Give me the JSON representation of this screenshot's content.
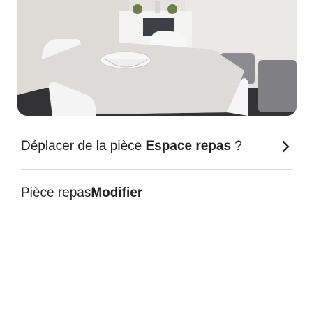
{
  "photo": {
    "alt_icon": "dining-room-photo"
  },
  "move_room": {
    "prefix": "Déplacer de la pièce ",
    "room_name": "Espace repas",
    "suffix": " ?",
    "chevron_icon": "chevron-right-icon"
  },
  "room": {
    "label": "Pièce repas ",
    "action": "Modifier"
  }
}
